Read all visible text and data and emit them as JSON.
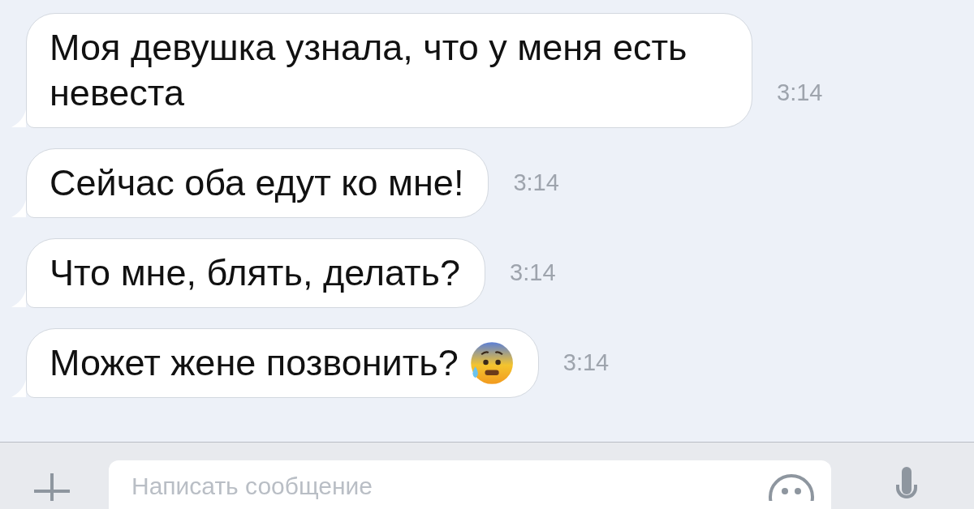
{
  "messages": [
    {
      "text": "Моя девушка узнала, что у меня есть невеста",
      "time": "3:14",
      "emoji": false
    },
    {
      "text": "Сейчас оба едут ко мне!",
      "time": "3:14",
      "emoji": false
    },
    {
      "text": "Что мне, блять, делать?",
      "time": "3:14",
      "emoji": false
    },
    {
      "text": "Может жене позвонить?",
      "time": "3:14",
      "emoji": true
    }
  ],
  "composer": {
    "placeholder": "Написать сообщение"
  }
}
